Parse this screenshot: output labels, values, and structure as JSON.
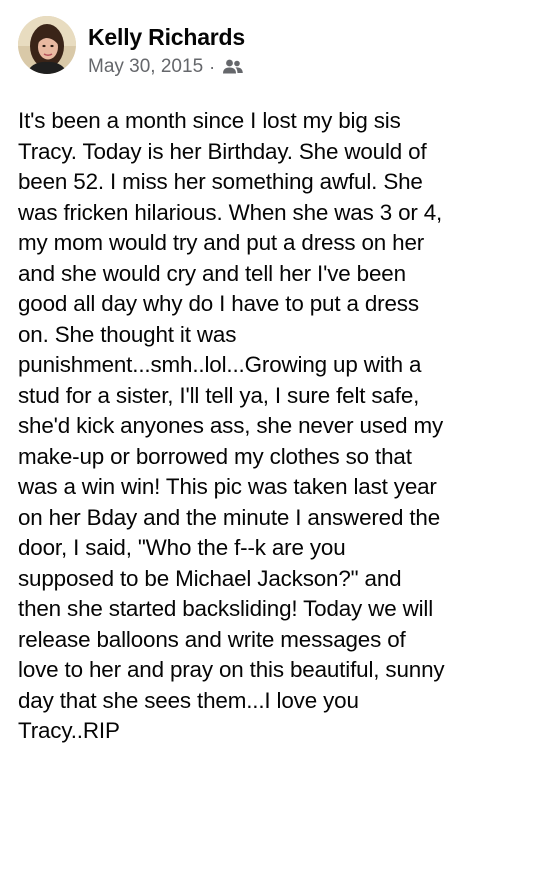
{
  "post": {
    "author": {
      "name": "Kelly Richards",
      "avatar_icon": "profile-photo"
    },
    "date": "May 30, 2015",
    "separator": "·",
    "audience_icon": "friends-icon",
    "text_lines": [
      "It's been a month since I lost my big sis",
      "Tracy. Today is her Birthday. She would of",
      "been 52. I miss her something awful. She",
      "was fricken hilarious. When she was 3 or 4,",
      "my mom would try and put a dress on her",
      "and she would cry and tell her I've been",
      "good all day why do I have to put a dress",
      "on. She thought it was",
      "punishment...smh..lol...Growing up with a",
      "stud for a sister, I'll tell ya, I  sure felt safe,",
      "she'd kick anyones ass, she never used my",
      "make-up or borrowed my clothes so that",
      "was a win win! This pic was taken last year",
      "on her Bday and the minute I answered the",
      "door, I said, \"Who the f--k are you",
      "supposed to be Michael Jackson?\" and",
      "then she started backsliding! Today we will",
      "release balloons and write messages of",
      "love to her and pray on this beautiful, sunny",
      "day that she sees them...I love you",
      "Tracy..RIP"
    ]
  }
}
